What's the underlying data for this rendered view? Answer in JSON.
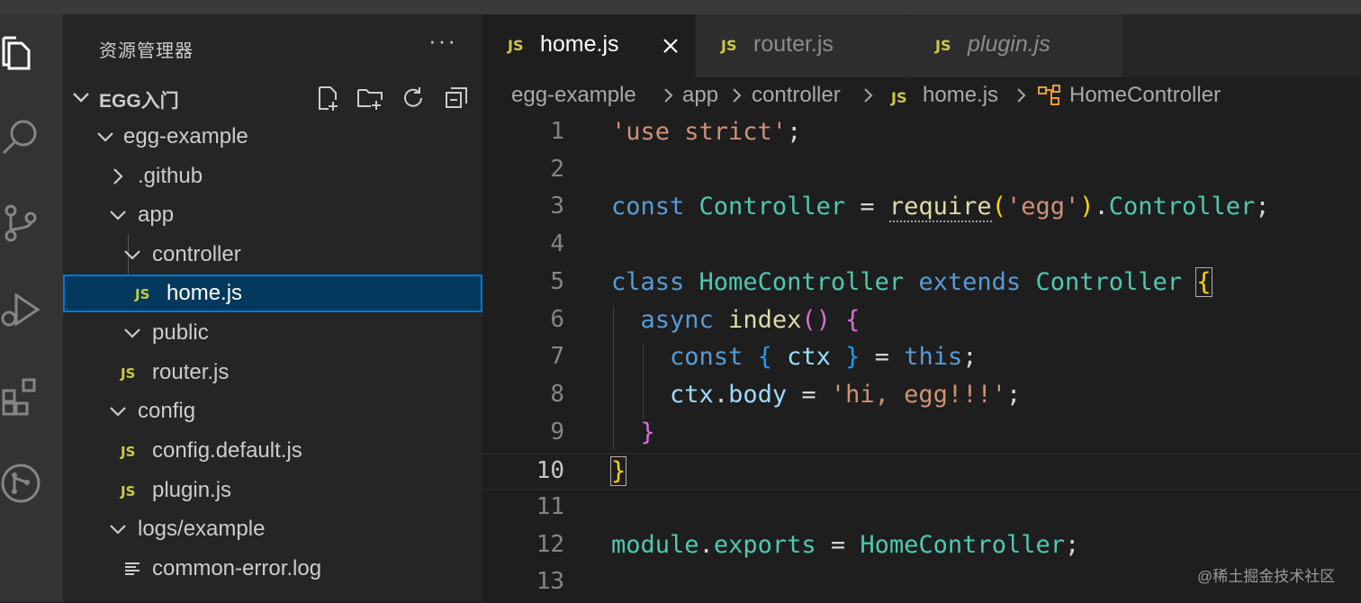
{
  "activity_bar": {
    "icons": [
      "explorer-icon",
      "search-icon",
      "source-control-icon",
      "run-debug-icon",
      "extensions-icon",
      "git-graph-icon"
    ]
  },
  "sidebar": {
    "title": "资源管理器",
    "more_label": "···",
    "workspace": {
      "name": "EGG入门",
      "tools": [
        "new-file-icon",
        "new-folder-icon",
        "refresh-icon",
        "collapse-all-icon"
      ]
    },
    "tree": [
      {
        "label": "egg-example",
        "kind": "folder",
        "expanded": true
      },
      {
        "label": ".github",
        "kind": "folder",
        "expanded": false
      },
      {
        "label": "app",
        "kind": "folder",
        "expanded": true
      },
      {
        "label": "controller",
        "kind": "folder",
        "expanded": true
      },
      {
        "label": "home.js",
        "kind": "js",
        "selected": true
      },
      {
        "label": "public",
        "kind": "folder",
        "expanded": true
      },
      {
        "label": "router.js",
        "kind": "js"
      },
      {
        "label": "config",
        "kind": "folder",
        "expanded": true
      },
      {
        "label": "config.default.js",
        "kind": "js"
      },
      {
        "label": "plugin.js",
        "kind": "js"
      },
      {
        "label": "logs/example",
        "kind": "folder",
        "expanded": true
      },
      {
        "label": "common-error.log",
        "kind": "log"
      }
    ]
  },
  "tabs": [
    {
      "label": "home.js",
      "badge": "JS",
      "active": true
    },
    {
      "label": "router.js",
      "badge": "JS",
      "active": false
    },
    {
      "label": "plugin.js",
      "badge": "JS",
      "active": false,
      "preview": true
    }
  ],
  "breadcrumb": {
    "items": [
      "egg-example",
      "app",
      "controller",
      "home.js",
      "HomeController"
    ],
    "js_badge": "JS"
  },
  "editor": {
    "current_line": 10,
    "lines": [
      {
        "n": "1",
        "tokens": [
          [
            "str",
            "'use strict'"
          ],
          [
            "p",
            ";"
          ]
        ]
      },
      {
        "n": "2",
        "tokens": []
      },
      {
        "n": "3",
        "tokens": [
          [
            "kw",
            "const"
          ],
          [
            "p",
            " "
          ],
          [
            "cls",
            "Controller"
          ],
          [
            "p",
            " = "
          ],
          [
            "fn-sq",
            "require"
          ],
          [
            "br1",
            "("
          ],
          [
            "str",
            "'egg'"
          ],
          [
            "br1",
            ")"
          ],
          [
            "p",
            "."
          ],
          [
            "cls",
            "Controller"
          ],
          [
            "p",
            ";"
          ]
        ]
      },
      {
        "n": "4",
        "tokens": []
      },
      {
        "n": "5",
        "tokens": [
          [
            "kw",
            "class"
          ],
          [
            "p",
            " "
          ],
          [
            "cls",
            "HomeController"
          ],
          [
            "p",
            " "
          ],
          [
            "kw",
            "extends"
          ],
          [
            "p",
            " "
          ],
          [
            "cls",
            "Controller"
          ],
          [
            "p",
            " "
          ],
          [
            "br1m",
            "{"
          ]
        ]
      },
      {
        "n": "6",
        "tokens": [
          [
            "p",
            "  "
          ],
          [
            "kw",
            "async"
          ],
          [
            "p",
            " "
          ],
          [
            "fn",
            "index"
          ],
          [
            "br2",
            "()"
          ],
          [
            "p",
            " "
          ],
          [
            "br2",
            "{"
          ]
        ]
      },
      {
        "n": "7",
        "tokens": [
          [
            "p",
            "    "
          ],
          [
            "kw",
            "const"
          ],
          [
            "p",
            " "
          ],
          [
            "br3",
            "{"
          ],
          [
            "p",
            " "
          ],
          [
            "var",
            "ctx"
          ],
          [
            "p",
            " "
          ],
          [
            "br3",
            "}"
          ],
          [
            "p",
            " = "
          ],
          [
            "kw",
            "this"
          ],
          [
            "p",
            ";"
          ]
        ]
      },
      {
        "n": "8",
        "tokens": [
          [
            "p",
            "    "
          ],
          [
            "var",
            "ctx"
          ],
          [
            "p",
            "."
          ],
          [
            "var",
            "body"
          ],
          [
            "p",
            " = "
          ],
          [
            "str",
            "'hi, egg!!!'"
          ],
          [
            "p",
            ";"
          ]
        ]
      },
      {
        "n": "9",
        "tokens": [
          [
            "p",
            "  "
          ],
          [
            "br2",
            "}"
          ]
        ]
      },
      {
        "n": "10",
        "tokens": [
          [
            "br1m",
            "}"
          ]
        ]
      },
      {
        "n": "11",
        "tokens": []
      },
      {
        "n": "12",
        "tokens": [
          [
            "cls",
            "module"
          ],
          [
            "p",
            "."
          ],
          [
            "cls",
            "exports"
          ],
          [
            "p",
            " = "
          ],
          [
            "cls",
            "HomeController"
          ],
          [
            "p",
            ";"
          ]
        ]
      },
      {
        "n": "13",
        "tokens": []
      }
    ]
  },
  "watermark": "@稀土掘金技术社区",
  "colors": {
    "string": "#ce9178",
    "keyword": "#569cd6",
    "class": "#4ec9b0",
    "function": "#dcdcaa",
    "variable": "#9cdcfe",
    "js_badge": "#cbcb41",
    "selection": "#04395e",
    "focus_border": "#0078d4"
  }
}
